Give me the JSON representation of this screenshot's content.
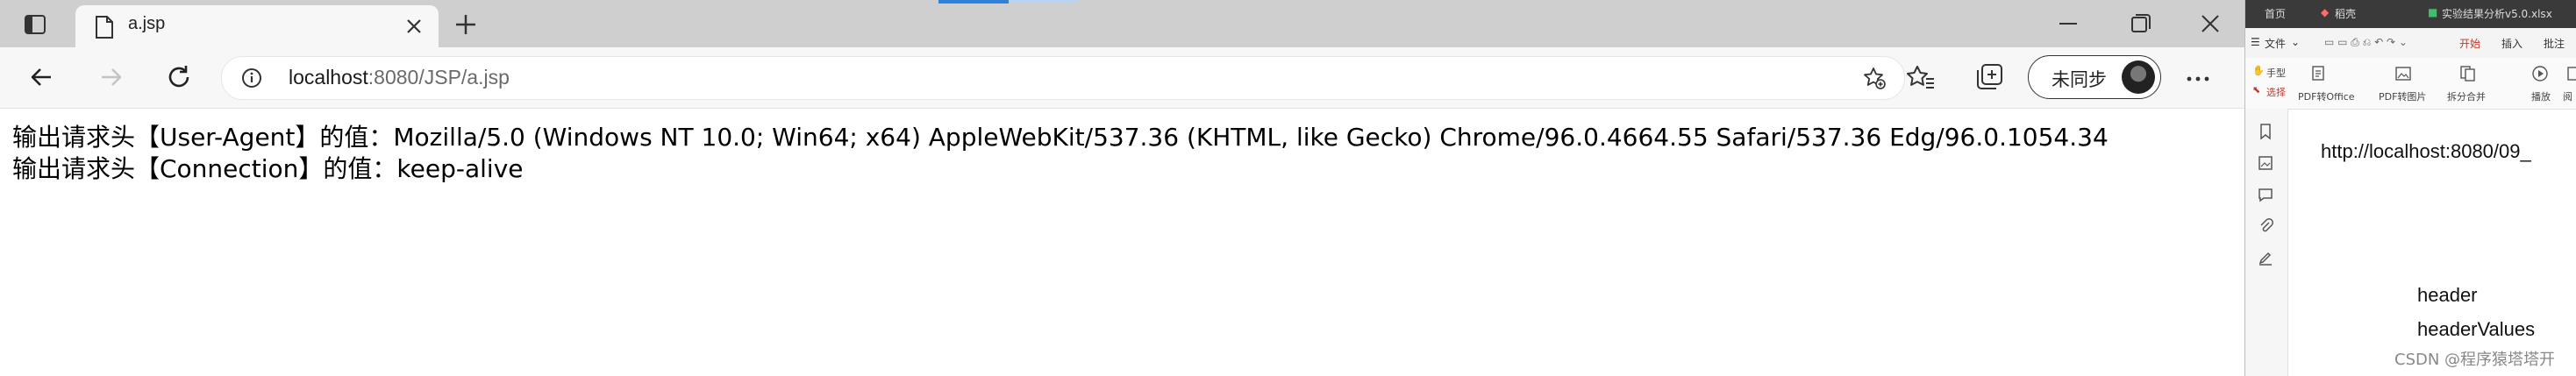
{
  "browser": {
    "tab_title": "a.jsp",
    "url_host": "localhost",
    "url_rest": ":8080/JSP/a.jsp",
    "sync_label": "未同步"
  },
  "page": {
    "lines": [
      "输出请求头【User-Agent】的值：Mozilla/5.0 (Windows NT 10.0; Win64; x64) AppleWebKit/537.36 (KHTML, like Gecko) Chrome/96.0.4664.55 Safari/537.36 Edg/96.0.1054.34",
      "输出请求头【Connection】的值：keep-alive"
    ]
  },
  "side_app": {
    "tabs": [
      "首页",
      "稻壳",
      "实验结果分析v5.0.xlsx"
    ],
    "menu": [
      "文件",
      "开始",
      "插入",
      "批注"
    ],
    "ribbon": {
      "hand": "手型",
      "select": "选择",
      "pdf_to_office": "PDF转Office",
      "pdf_to_image": "PDF转图片",
      "split_merge": "拆分合并",
      "play": "播放",
      "read": "阅"
    },
    "doc_url": "http://localhost:8080/09_",
    "doc_words": [
      "header",
      "headerValues"
    ]
  },
  "watermark": "CSDN @程序猿塔塔开",
  "colors": {
    "accent": "#2f80d8",
    "active_menu": "#c0392b"
  }
}
